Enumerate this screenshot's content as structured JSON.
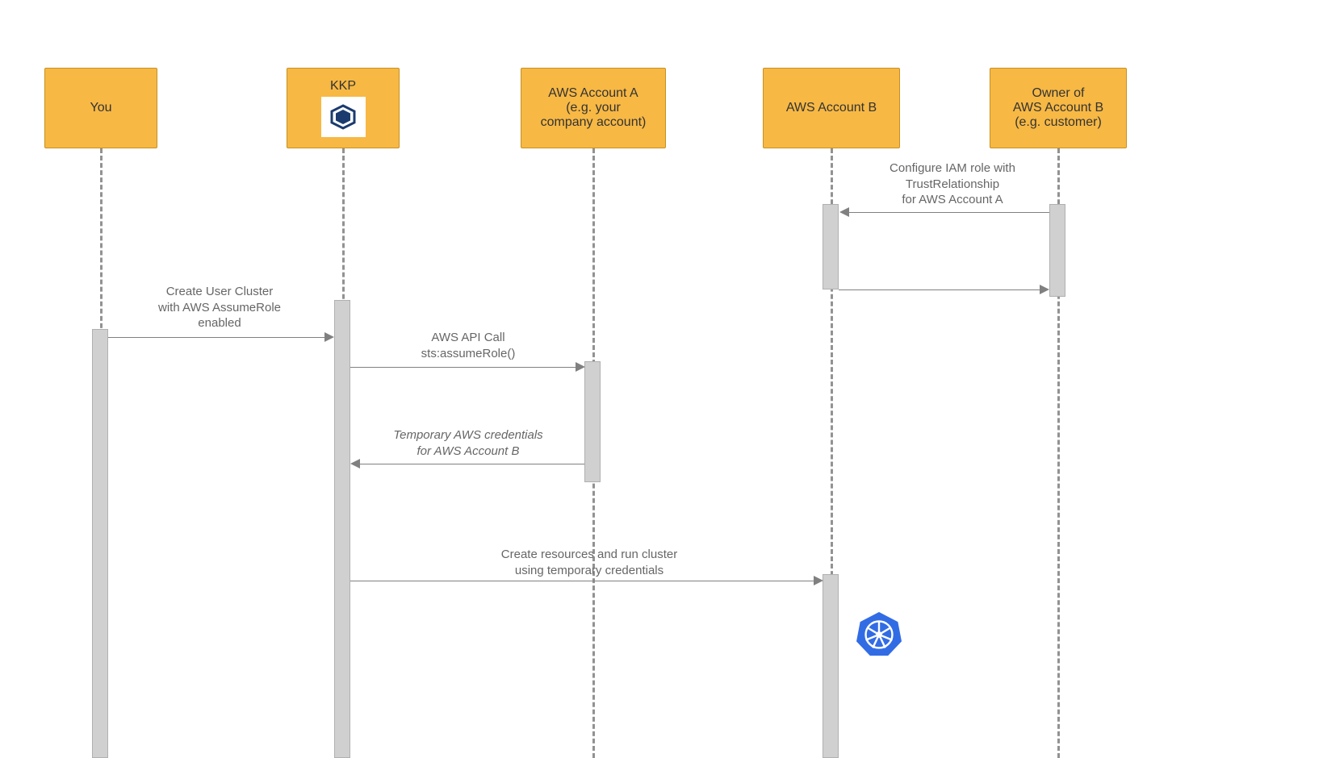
{
  "participants": {
    "you": "You",
    "kkp": "KKP",
    "awsA_line1": "AWS Account A",
    "awsA_line2": "(e.g. your",
    "awsA_line3": "company account)",
    "awsB": "AWS Account B",
    "owner_line1": "Owner of",
    "owner_line2": "AWS Account B",
    "owner_line3": "(e.g. customer)"
  },
  "messages": {
    "m1_l1": "Configure IAM role with",
    "m1_l2": "TrustRelationship",
    "m1_l3": "for AWS Account A",
    "m2_l1": "Create User Cluster",
    "m2_l2": "with AWS AssumeRole",
    "m2_l3": "enabled",
    "m3_l1": "AWS API Call",
    "m3_l2": "sts:assumeRole()",
    "m4_l1": "Temporary AWS credentials",
    "m4_l2": "for AWS Account B",
    "m5_l1": "Create resources and run cluster",
    "m5_l2": "using temporary credentials"
  },
  "chart_data": {
    "type": "sequence-diagram",
    "participants": [
      "You",
      "KKP",
      "AWS Account A (e.g. your company account)",
      "AWS Account B",
      "Owner of AWS Account B (e.g. customer)"
    ],
    "interactions": [
      {
        "from": "Owner of AWS Account B",
        "to": "AWS Account B",
        "label": "Configure IAM role with TrustRelationship for AWS Account A",
        "type": "sync"
      },
      {
        "from": "AWS Account B",
        "to": "Owner of AWS Account B",
        "label": "",
        "type": "return"
      },
      {
        "from": "You",
        "to": "KKP",
        "label": "Create User Cluster with AWS AssumeRole enabled",
        "type": "sync"
      },
      {
        "from": "KKP",
        "to": "AWS Account A",
        "label": "AWS API Call sts:assumeRole()",
        "type": "sync"
      },
      {
        "from": "AWS Account A",
        "to": "KKP",
        "label": "Temporary AWS credentials for AWS Account B",
        "type": "return"
      },
      {
        "from": "KKP",
        "to": "AWS Account B",
        "label": "Create resources and run cluster using temporary credentials",
        "type": "sync"
      }
    ],
    "notes": [
      {
        "near": "AWS Account B",
        "symbol": "kubernetes-logo",
        "at": "after last interaction"
      }
    ]
  }
}
